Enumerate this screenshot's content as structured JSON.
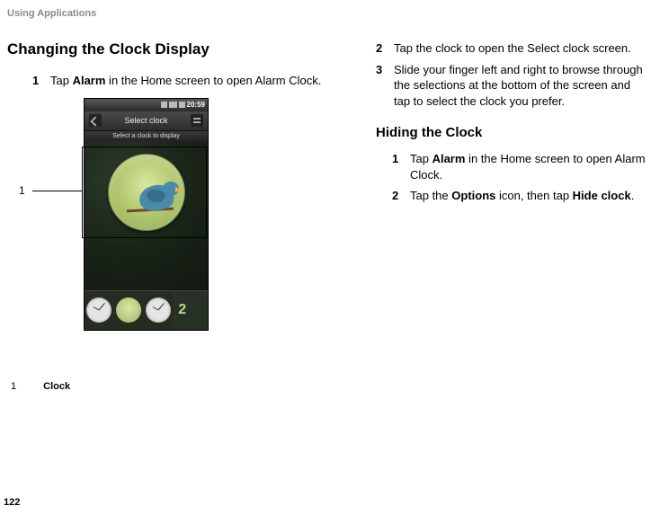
{
  "header": {
    "title": "Using Applications"
  },
  "section1": {
    "heading": "Changing the Clock Display",
    "steps": [
      {
        "n": "1",
        "text_before": "Tap ",
        "bold": "Alarm",
        "text_after": " in the Home screen to open Alarm Clock."
      }
    ]
  },
  "phone": {
    "status_time": "20:59",
    "title_bar": "Select clock",
    "subtitle": "Select a clock to display",
    "digital_preview": "2"
  },
  "callout": {
    "num": "1"
  },
  "legend": {
    "num": "1",
    "label": "Clock"
  },
  "right_steps_top": [
    {
      "n": "2",
      "text": "Tap the clock to open the Select clock screen."
    },
    {
      "n": "3",
      "text": "Slide your finger left and right to browse through the selections at the bottom of the screen and tap to select the clock you prefer."
    }
  ],
  "section2": {
    "heading": "Hiding the Clock",
    "steps": [
      {
        "n": "1",
        "text_before": "Tap ",
        "bold": "Alarm",
        "text_after": " in the Home screen to open Alarm Clock."
      },
      {
        "n": "2",
        "text_before": "Tap the ",
        "bold": "Options",
        "text_mid": " icon, then tap ",
        "bold2": "Hide clock",
        "text_after": "."
      }
    ]
  },
  "page_number": "122"
}
